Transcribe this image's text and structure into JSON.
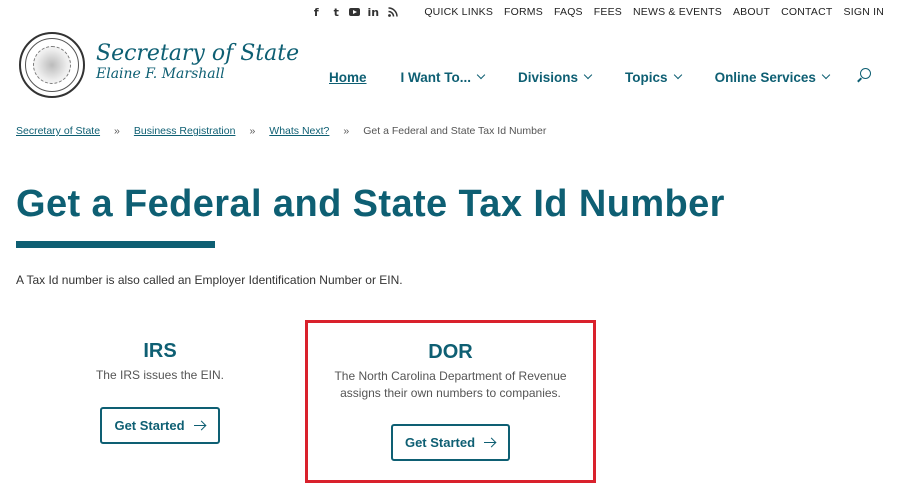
{
  "social": {
    "facebook": "f",
    "twitter": "t",
    "linkedin": "in",
    "icons": [
      "facebook-icon",
      "twitter-icon",
      "youtube-icon",
      "linkedin-icon",
      "rss-icon"
    ]
  },
  "utility_links": [
    "QUICK LINKS",
    "FORMS",
    "FAQS",
    "FEES",
    "NEWS & EVENTS",
    "ABOUT",
    "CONTACT",
    "SIGN IN"
  ],
  "logo": {
    "title": "Secretary of State",
    "subtitle": "Elaine F. Marshall"
  },
  "nav": {
    "home": "Home",
    "i_want_to": "I Want To...",
    "divisions": "Divisions",
    "topics": "Topics",
    "online_services": "Online Services"
  },
  "breadcrumb": {
    "items": [
      "Secretary of State",
      "Business Registration",
      "Whats Next?"
    ],
    "current": "Get a Federal and State Tax Id Number",
    "separator": "»"
  },
  "page": {
    "title": "Get a Federal and State Tax Id Number",
    "intro": "A Tax Id number is also called an Employer Identification Number or EIN."
  },
  "cards": [
    {
      "title": "IRS",
      "description": "The IRS issues the EIN.",
      "button": "Get Started"
    },
    {
      "title": "DOR",
      "description_line1": "The North Carolina Department of Revenue",
      "description_line2": "assigns their own numbers to companies.",
      "button": "Get Started"
    }
  ],
  "colors": {
    "brand": "#0e5f73",
    "highlight_border": "#d9212c"
  }
}
